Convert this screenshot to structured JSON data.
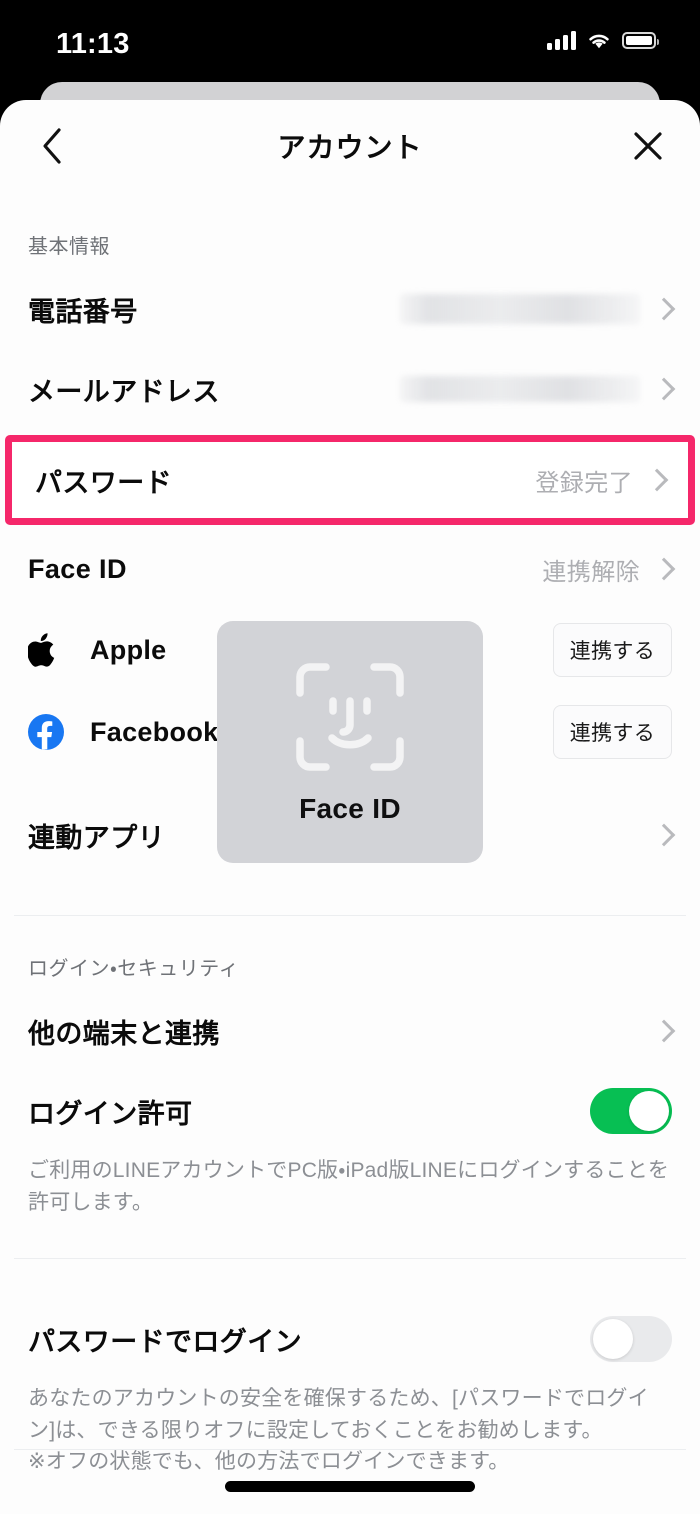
{
  "status_bar": {
    "time": "11:13",
    "cellular_icon": "cellular-signal-icon",
    "wifi_icon": "wifi-icon",
    "battery_icon": "battery-icon"
  },
  "header": {
    "title": "アカウント",
    "back_icon": "chevron-left-icon",
    "close_icon": "close-icon"
  },
  "sections": [
    {
      "label": "基本情報",
      "rows": [
        {
          "title": "電話番号",
          "value": "",
          "redacted": true,
          "chevron": true
        },
        {
          "title": "メールアドレス",
          "value": "",
          "redacted": true,
          "chevron": true
        },
        {
          "title": "パスワード",
          "value": "登録完了",
          "redacted": false,
          "chevron": true,
          "highlighted": true
        },
        {
          "title": "Face ID",
          "value": "連携解除",
          "redacted": false,
          "chevron": true
        },
        {
          "title": "Apple",
          "icon": "apple-logo-icon",
          "button_label": "連携する"
        },
        {
          "title": "Facebook",
          "icon": "facebook-logo-icon",
          "button_label": "連携する"
        },
        {
          "title": "連動アプリ",
          "value": "",
          "redacted": false,
          "chevron": true
        }
      ]
    },
    {
      "label": "ログイン・セキュリティ",
      "rows": [
        {
          "title": "他の端末と連携",
          "value": "",
          "chevron": true
        },
        {
          "title": "ログイン許可",
          "toggle": "on",
          "description": "ご利用のLINEアカウントでPC版・iPad版LINEにログインすることを許可します。"
        },
        {
          "title": "パスワードでログイン",
          "toggle": "off",
          "description": "あなたのアカウントの安全を確保するため、[パスワードでログイン]は、できる限りオフに設定しておくことをお勧めします。\n※オフの状態でも、他の方法でログインできます。"
        }
      ]
    }
  ],
  "overlay": {
    "face_id_card": {
      "label": "Face ID",
      "icon": "face-id-scan-icon",
      "background_color": "#d2d3d7"
    }
  },
  "colors": {
    "highlight_pink": "#f5276a",
    "toggle_on_green": "#07bf53",
    "toggle_off_gray": "#e9eaec",
    "facebook_blue": "#1877f2",
    "sheet_background": "#fdfdfd",
    "muted_text": "#adaeb2"
  },
  "home_indicator": "home-indicator-bar"
}
